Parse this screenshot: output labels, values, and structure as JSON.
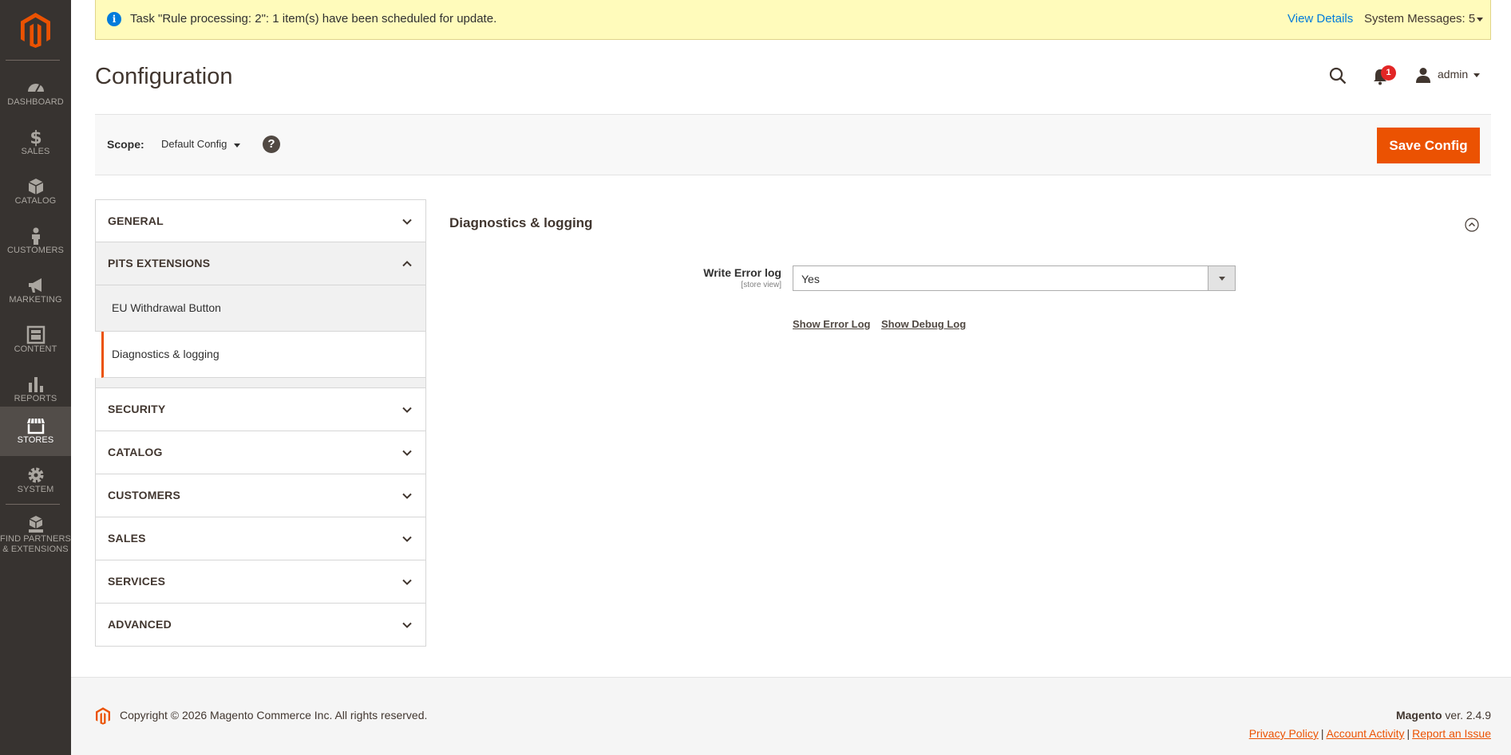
{
  "sidebar": {
    "items": [
      {
        "label": "DASHBOARD",
        "icon": "dashboard-icon"
      },
      {
        "label": "SALES",
        "icon": "dollar-icon"
      },
      {
        "label": "CATALOG",
        "icon": "box-icon"
      },
      {
        "label": "CUSTOMERS",
        "icon": "person-icon"
      },
      {
        "label": "MARKETING",
        "icon": "megaphone-icon"
      },
      {
        "label": "CONTENT",
        "icon": "layout-icon"
      },
      {
        "label": "REPORTS",
        "icon": "bar-chart-icon"
      },
      {
        "label": "STORES",
        "icon": "storefront-icon"
      },
      {
        "label": "SYSTEM",
        "icon": "gear-icon"
      },
      {
        "label": "FIND PARTNERS & EXTENSIONS",
        "icon": "boxes-icon"
      }
    ]
  },
  "system_message": {
    "text": "Task \"Rule processing: 2\": 1 item(s) have been scheduled for update.",
    "view_details": "View Details",
    "system_messages": "System Messages: 5"
  },
  "header": {
    "title": "Configuration",
    "notification_count": "1",
    "user_name": "admin"
  },
  "scope": {
    "label": "Scope:",
    "value": "Default Config",
    "help": "?",
    "save_label": "Save Config"
  },
  "tabs": {
    "general": "GENERAL",
    "pits_extensions": "PITS EXTENSIONS",
    "pits_items": [
      "EU Withdrawal Button",
      "Diagnostics & logging"
    ],
    "security": "SECURITY",
    "catalog": "CATALOG",
    "customers": "CUSTOMERS",
    "sales": "SALES",
    "services": "SERVICES",
    "advanced": "ADVANCED"
  },
  "main": {
    "section_title": "Diagnostics & logging",
    "field_label": "Write Error log",
    "field_scope": "[store view]",
    "field_value": "Yes",
    "show_error_log": "Show Error Log",
    "show_debug_log": "Show Debug Log"
  },
  "footer": {
    "copyright": "Copyright © 2026 Magento Commerce Inc. All rights reserved.",
    "brand": "Magento",
    "version": " ver. 2.4.9",
    "links": [
      "Privacy Policy",
      "Account Activity",
      "Report an Issue"
    ],
    "separator": "|"
  },
  "colors": {
    "accent": "#eb5202",
    "sidebar_bg": "#373330",
    "message_bg": "#fffbbb",
    "link_blue": "#007bdb"
  }
}
